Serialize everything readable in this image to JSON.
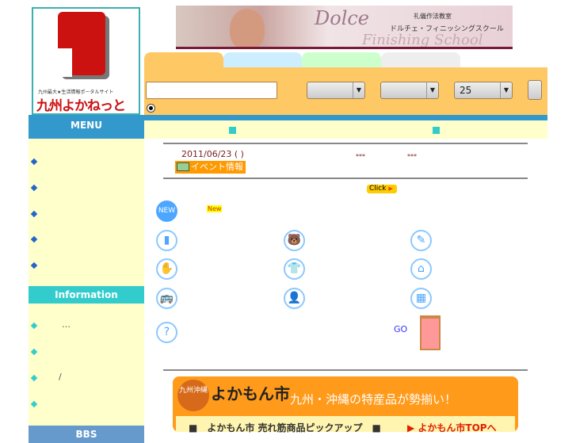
{
  "logo": {
    "subtitle": "九州最大★生活情報ポータルサイト",
    "name": "九州よかねっと"
  },
  "banner": {
    "title": "Dolce",
    "subtitle": "礼儀作法教室",
    "subtitle2": "ドルチェ・フィニッシングスクール",
    "script": "Finishing School"
  },
  "search": {
    "value": "",
    "select1": "",
    "select2": "",
    "select3": "25",
    "arrow": "▼"
  },
  "sidebar": {
    "menu_title": "MENU",
    "info_title": "Information",
    "info_items": [
      "…",
      "",
      "/",
      ""
    ],
    "bbs_title": "BBS"
  },
  "news": {
    "date": "2011/06/23 ( )",
    "dots1": "***",
    "dots2": "***",
    "event_label": "イベント情報",
    "click_label": "Click",
    "click_arrow": "▶"
  },
  "new_badge": "NEW",
  "new_tag": "New",
  "icons": [
    "▮",
    "🐻",
    "✎",
    "✋",
    "👕",
    "⌂",
    "🚌",
    "👤",
    "▦",
    "?"
  ],
  "go_label": "GO",
  "yokamon": {
    "circle": "九州沖縄",
    "name": "よかもん市",
    "tagline": "九州・沖縄の特産品が勢揃い！",
    "pickup": "■　よかもん市 売れ筋商品ピックアップ　■",
    "top_link": "▶ よかもん市TOPへ"
  }
}
